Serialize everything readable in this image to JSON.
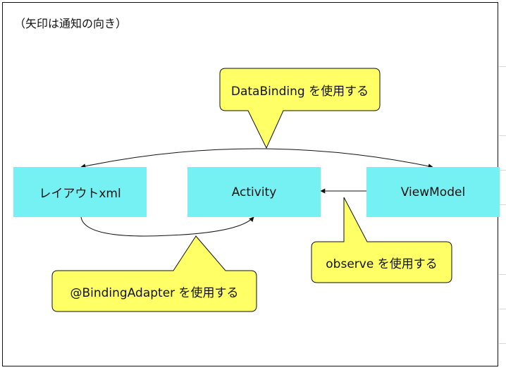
{
  "note": "（矢印は通知の向き）",
  "nodes": {
    "layout": "レイアウトxml",
    "activity": "Activity",
    "viewmodel": "ViewModel"
  },
  "callouts": {
    "databinding": "DataBinding を使用する",
    "observe": "observe を使用する",
    "binding_adapter": "@BindingAdapter を使用する"
  },
  "colors": {
    "node_fill": "#76f1f3",
    "callout_fill": "#ffff66",
    "stroke": "#111111"
  }
}
